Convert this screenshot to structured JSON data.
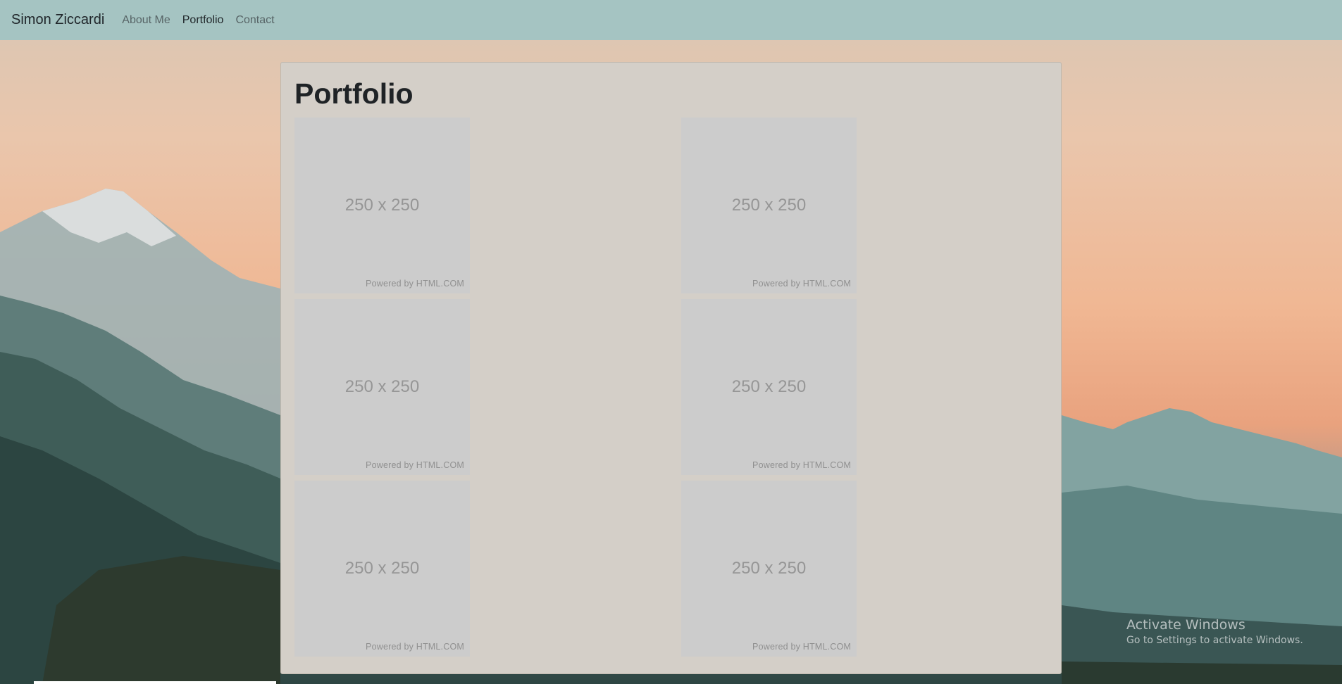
{
  "navbar": {
    "brand": "Simon Ziccardi",
    "links": [
      {
        "label": "About Me",
        "active": false
      },
      {
        "label": "Portfolio",
        "active": true
      },
      {
        "label": "Contact",
        "active": false
      }
    ],
    "background": "#a5c4c2"
  },
  "main": {
    "title": "Portfolio",
    "tiles": [
      {
        "dimensions": "250 x 250",
        "credit": "Powered by HTML.COM"
      },
      {
        "dimensions": "250 x 250",
        "credit": "Powered by HTML.COM"
      },
      {
        "dimensions": "250 x 250",
        "credit": "Powered by HTML.COM"
      },
      {
        "dimensions": "250 x 250",
        "credit": "Powered by HTML.COM"
      },
      {
        "dimensions": "250 x 250",
        "credit": "Powered by HTML.COM"
      },
      {
        "dimensions": "250 x 250",
        "credit": "Powered by HTML.COM"
      }
    ]
  },
  "watermark": {
    "title": "Activate Windows",
    "subtitle": "Go to Settings to activate Windows."
  },
  "colors": {
    "card": "#d4cfc8",
    "placeholder": "#cccccc",
    "sky_top": "#d9c6b4",
    "sky_glow": "#f0b793",
    "mountain_dark": "#2e4643"
  }
}
